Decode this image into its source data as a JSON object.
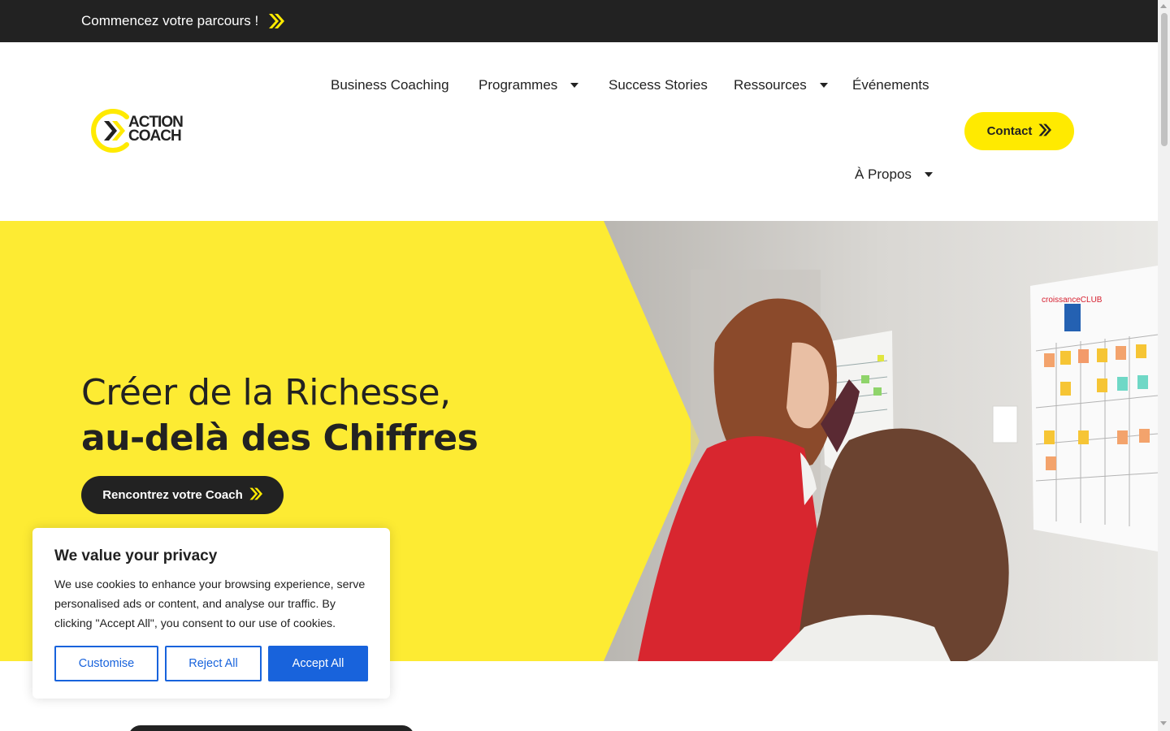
{
  "topbar": {
    "link_label": "Commencez votre parcours !",
    "icon": "double-chevron-right-icon"
  },
  "logo": {
    "line1": "ACTION",
    "line2": "COACH"
  },
  "nav": {
    "items": [
      {
        "label": "Business Coaching",
        "has_dropdown": false
      },
      {
        "label": "Programmes",
        "has_dropdown": true
      },
      {
        "label": "Success Stories",
        "has_dropdown": false
      },
      {
        "label": "Ressources",
        "has_dropdown": true
      },
      {
        "label": "Événements",
        "has_dropdown": false
      },
      {
        "label": "À Propos",
        "has_dropdown": true
      }
    ],
    "contact_label": "Contact"
  },
  "hero": {
    "title_line1": "Créer de la Richesse,",
    "title_line2": "au-delà des Chiffres",
    "cta_label": "Rencontrez votre Coach",
    "photo_board_brand": "croissanceCLUB"
  },
  "cookie": {
    "title": "We value your privacy",
    "body": "We use cookies to enhance your browsing experience, serve personalised ads or content, and analyse our traffic. By clicking \"Accept All\", you consent to our use of cookies.",
    "customise_label": "Customise",
    "reject_label": "Reject All",
    "accept_label": "Accept All"
  },
  "colors": {
    "brand_yellow": "#ffea00",
    "hero_yellow": "#fdeb33",
    "dark": "#222222",
    "cookie_blue": "#1863dc"
  }
}
